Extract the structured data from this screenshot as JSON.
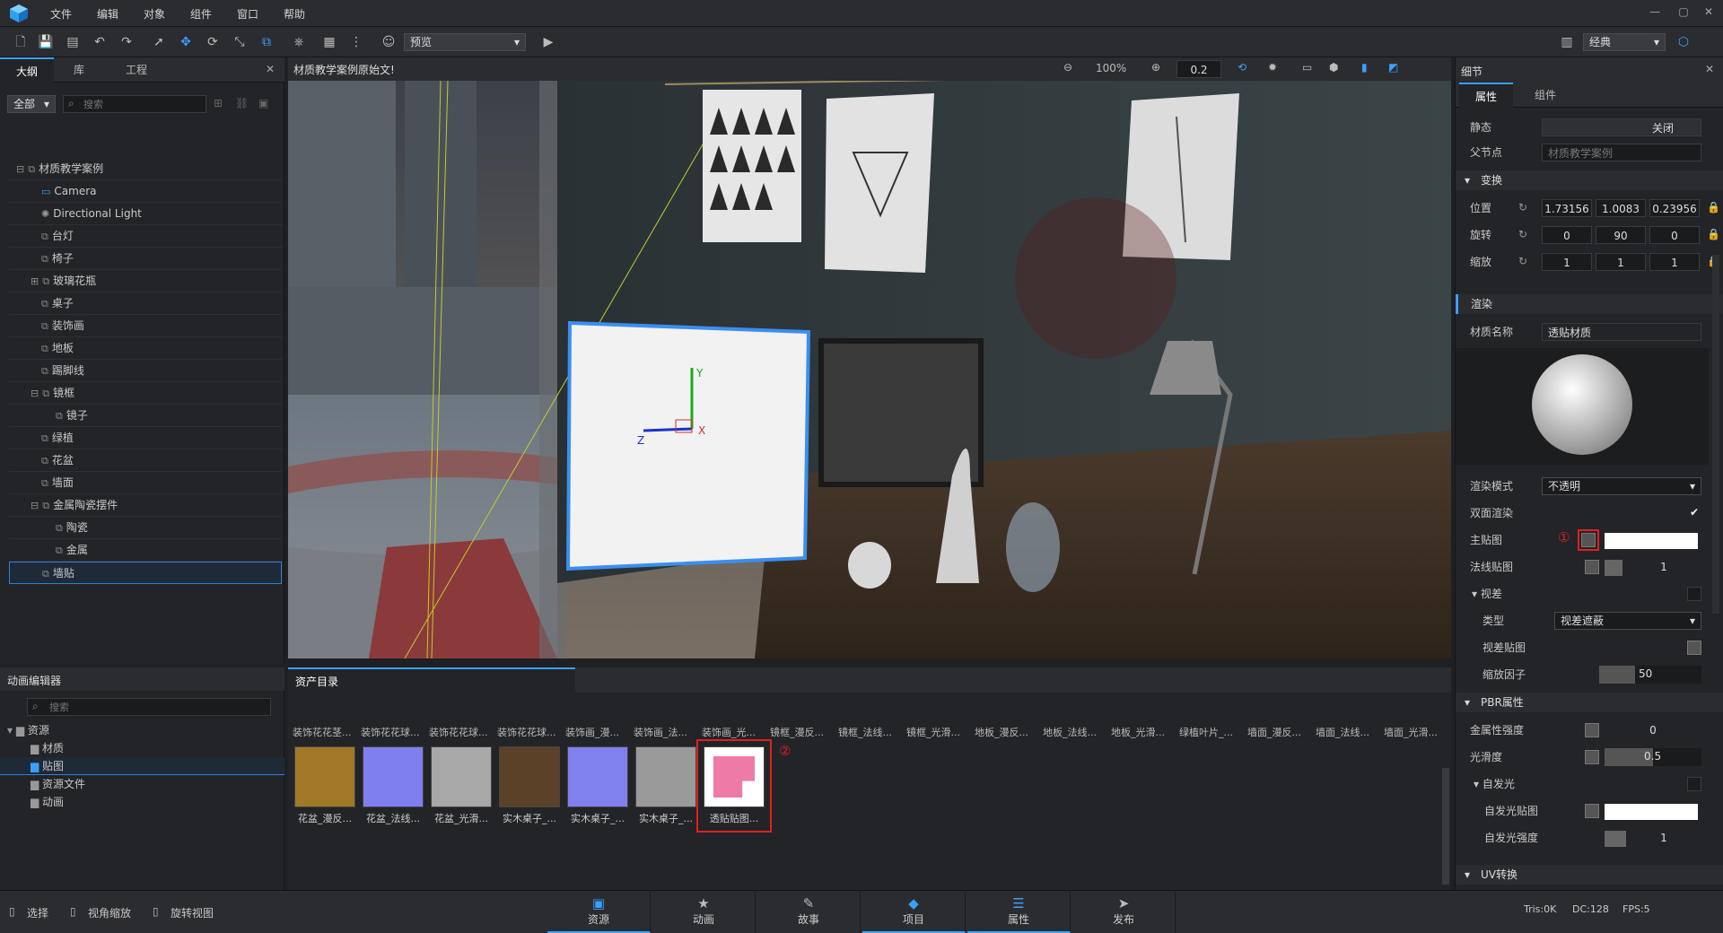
{
  "menu": {
    "items": [
      "文件",
      "编辑",
      "对象",
      "组件",
      "窗口",
      "帮助"
    ]
  },
  "toolbar": {
    "preview_label": "预览",
    "layout_label": "经典"
  },
  "left_panel": {
    "tabs": [
      "大纲",
      "库",
      "工程"
    ],
    "filter_label": "全部",
    "search_placeholder": "搜索",
    "tree": [
      {
        "label": "材质教学案例",
        "depth": 0,
        "expand": "⊟"
      },
      {
        "label": "Camera",
        "depth": 1,
        "expand": ""
      },
      {
        "label": "Directional Light",
        "depth": 1,
        "expand": ""
      },
      {
        "label": "台灯",
        "depth": 1,
        "expand": ""
      },
      {
        "label": "椅子",
        "depth": 1,
        "expand": ""
      },
      {
        "label": "玻璃花瓶",
        "depth": 1,
        "expand": "⊞"
      },
      {
        "label": "桌子",
        "depth": 1,
        "expand": ""
      },
      {
        "label": "装饰画",
        "depth": 1,
        "expand": ""
      },
      {
        "label": "地板",
        "depth": 1,
        "expand": ""
      },
      {
        "label": "踢脚线",
        "depth": 1,
        "expand": ""
      },
      {
        "label": "镜框",
        "depth": 1,
        "expand": "⊟"
      },
      {
        "label": "镜子",
        "depth": 2,
        "expand": ""
      },
      {
        "label": "绿植",
        "depth": 1,
        "expand": ""
      },
      {
        "label": "花盆",
        "depth": 1,
        "expand": ""
      },
      {
        "label": "墙面",
        "depth": 1,
        "expand": ""
      },
      {
        "label": "金属陶瓷摆件",
        "depth": 1,
        "expand": "⊟"
      },
      {
        "label": "陶瓷",
        "depth": 2,
        "expand": ""
      },
      {
        "label": "金属",
        "depth": 2,
        "expand": ""
      },
      {
        "label": "墙贴",
        "depth": 1,
        "expand": "",
        "selected": true
      }
    ]
  },
  "viewport": {
    "title": "材质教学案例原始文!",
    "zoom": "100%",
    "snap": "0.2",
    "gizmo": {
      "y": "Y",
      "x": "X",
      "z": "Z"
    }
  },
  "right_panel": {
    "title": "细节",
    "tabs": [
      "属性",
      "组件"
    ],
    "static_label": "静态",
    "static_value": "关闭",
    "parent_label": "父节点",
    "parent_value": "材质教学案例",
    "transform_section": "变换",
    "position_label": "位置",
    "position": [
      "1.73156",
      "1.0083",
      "0.23956"
    ],
    "rotation_label": "旋转",
    "rotation": [
      "0",
      "90",
      "0"
    ],
    "scale_label": "缩放",
    "scale": [
      "1",
      "1",
      "1"
    ],
    "render_section": "渲染",
    "material_name_label": "材质名称",
    "material_name": "透贴材质",
    "render_mode_label": "渲染模式",
    "render_mode": "不透明",
    "double_side_label": "双面渲染",
    "main_map_label": "主贴图",
    "normal_map_label": "法线贴图",
    "normal_value": "1",
    "parallax_section": "视差",
    "type_label": "类型",
    "type_value": "视差遮蔽",
    "parallax_map_label": "视差贴图",
    "scale_factor_label": "缩放因子",
    "scale_factor": "50",
    "pbr_section": "PBR属性",
    "metal_label": "金属性强度",
    "metal_value": "0",
    "smooth_label": "光滑度",
    "smooth_value": "0.5",
    "emission_section": "自发光",
    "emission_map_label": "自发光贴图",
    "emission_strength_label": "自发光强度",
    "emission_strength": "1",
    "uv_section": "UV转换",
    "annotation1": "①"
  },
  "anim_panel": {
    "title": "动画编辑器",
    "search_placeholder": "搜索",
    "tree": [
      {
        "label": "资源",
        "depth": 0
      },
      {
        "label": "材质",
        "depth": 1
      },
      {
        "label": "贴图",
        "depth": 1,
        "selected": true
      },
      {
        "label": "资源文件",
        "depth": 1
      },
      {
        "label": "动画",
        "depth": 1
      }
    ]
  },
  "assets": {
    "title": "资产目录",
    "header_labels": [
      "装饰花花茎...",
      "装饰花花球...",
      "装饰花花球...",
      "装饰花花球...",
      "装饰画_漫...",
      "装饰画_法...",
      "装饰画_光...",
      "镜框_漫反...",
      "镜框_法线...",
      "镜框_光滑...",
      "地板_漫反...",
      "地板_法线...",
      "地板_光滑...",
      "绿植叶片_...",
      "墙面_漫反...",
      "墙面_法线...",
      "墙面_光滑..."
    ],
    "items": [
      {
        "label": "花盆_漫反...",
        "color": "#a07828"
      },
      {
        "label": "花盆_法线...",
        "color": "#7f7ff0"
      },
      {
        "label": "花盆_光滑...",
        "color": "#a8a8a8"
      },
      {
        "label": "实木桌子_...",
        "color": "#5a4128"
      },
      {
        "label": "实木桌子_...",
        "color": "#8080ee"
      },
      {
        "label": "实木桌子_...",
        "color": "#9a9a9a"
      },
      {
        "label": "透贴贴图...",
        "color": "#ee7aa8"
      }
    ],
    "annotation2": "②"
  },
  "status": {
    "left": [
      "选择",
      "视角缩放",
      "旋转视图"
    ],
    "tabs": [
      {
        "label": "资源",
        "icon": "▣"
      },
      {
        "label": "动画",
        "icon": "★"
      },
      {
        "label": "故事",
        "icon": "✎"
      },
      {
        "label": "项目",
        "icon": "◆"
      },
      {
        "label": "属性",
        "icon": "☰"
      },
      {
        "label": "发布",
        "icon": "➤"
      }
    ],
    "tris": "Tris:0K",
    "dc": "DC:128",
    "fps": "FPS:5"
  }
}
